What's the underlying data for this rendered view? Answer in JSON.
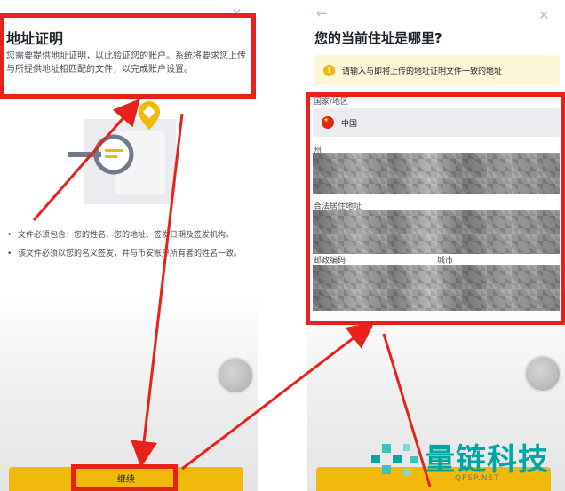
{
  "left": {
    "close_glyph": "✕",
    "title": "地址证明",
    "description": "您需要提供地址证明，以此验证您的账户。系统将要求您上传与所提供地址相匹配的文件，以完成账户设置。",
    "bullets": [
      "文件必须包含：您的姓名、您的地址、签发日期及签发机构。",
      "该文件必须以您的名义签发，并与币安账户所有者的姓名一致。"
    ],
    "continue_label": "继续"
  },
  "right": {
    "back_glyph": "←",
    "close_glyph": "✕",
    "title": "您的当前住址是哪里?",
    "notice": "请输入与即将上传的地址证明文件一致的地址",
    "fields": {
      "country_label": "国家/地区",
      "country_value": "中国",
      "state_label": "州",
      "address_label": "合法居住地址",
      "postal_label": "邮政编码",
      "city_label": "城市"
    }
  },
  "watermark": {
    "text": "量链科技",
    "sub": "QFSP.NET"
  },
  "colors": {
    "accent": "#f0b90b",
    "annotation": "#e8211b",
    "watermark": "#00a7a1"
  }
}
